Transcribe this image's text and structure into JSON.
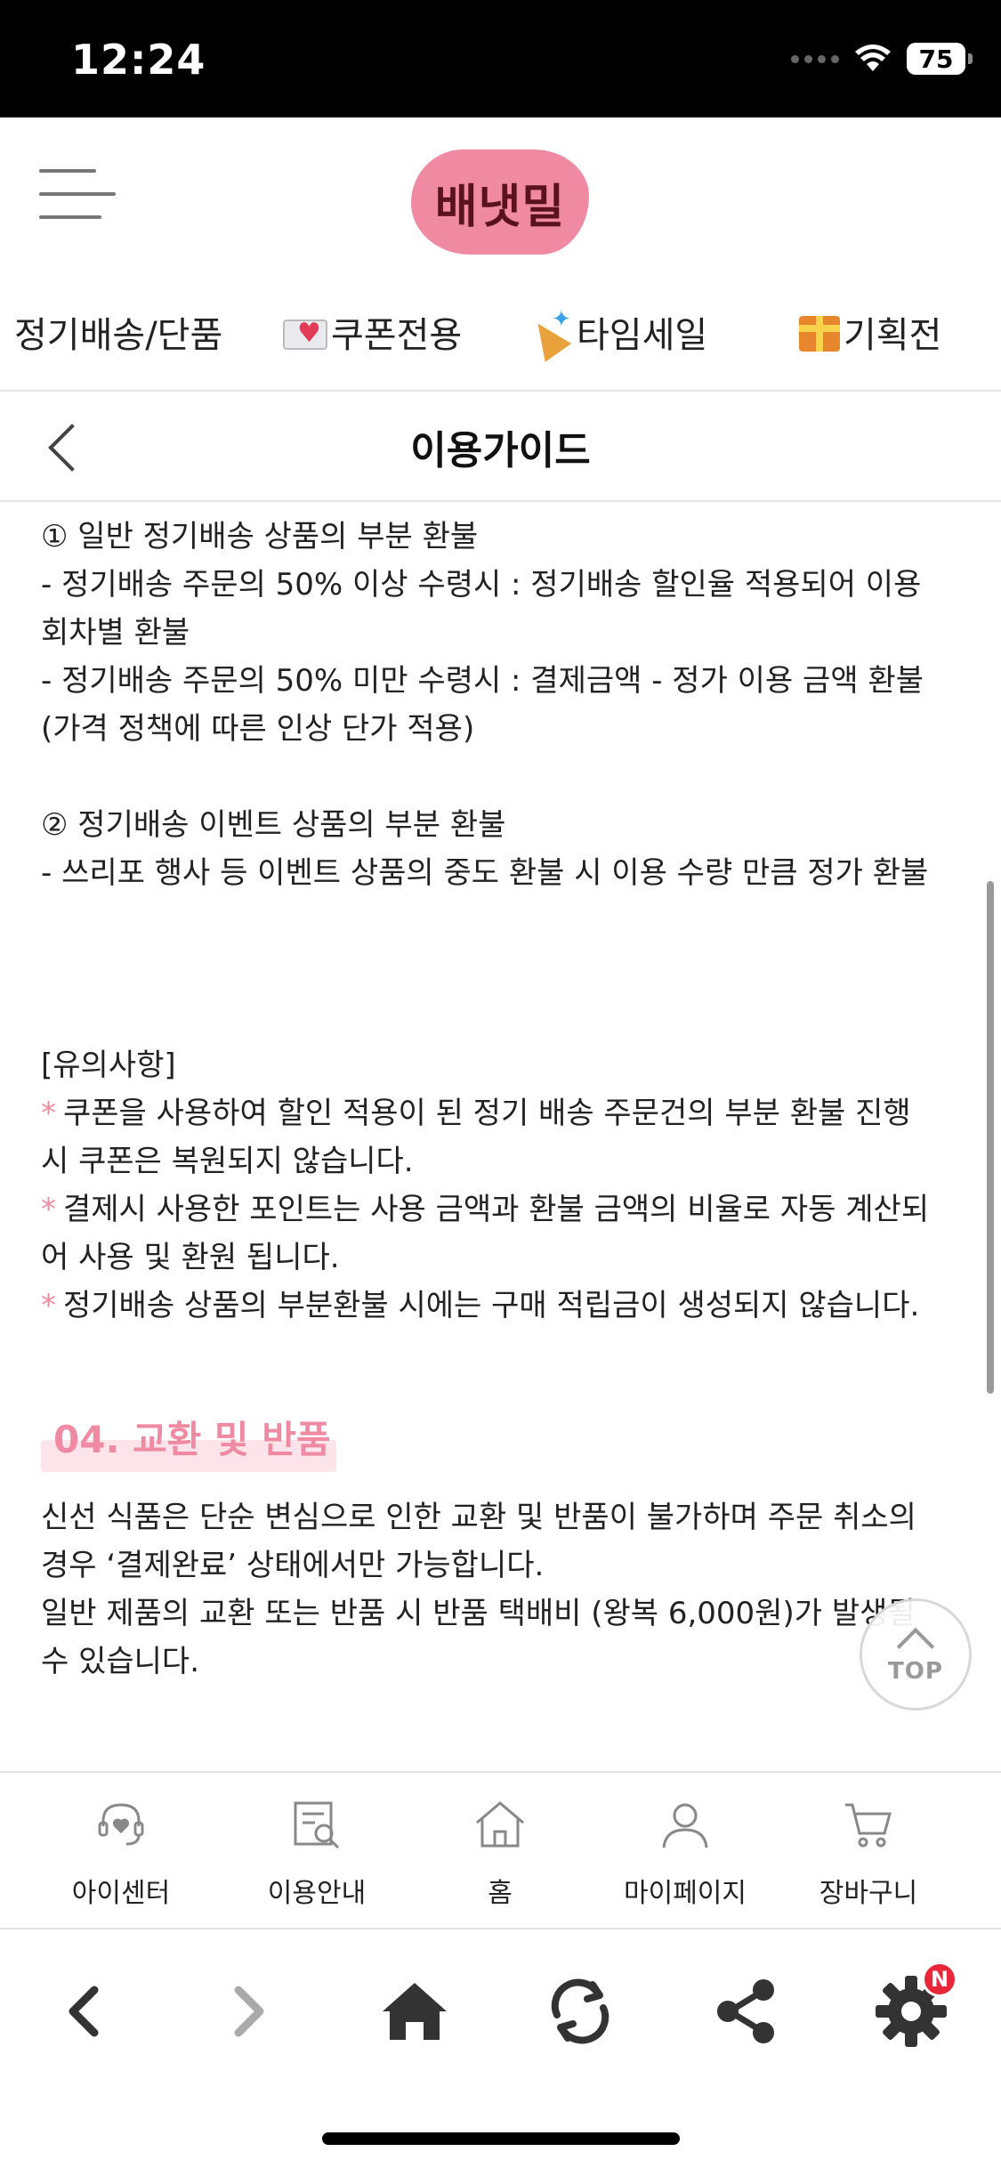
{
  "status_bar": {
    "time": "12:24",
    "battery": "75",
    "icons": [
      "signal-dots-icon",
      "wifi-icon",
      "battery-icon"
    ]
  },
  "header": {
    "logo_text": "배냇밀",
    "menu_icon": "hamburger-menu-icon",
    "colors": {
      "logo_bg": "#f08aa3",
      "logo_text": "#5a1120"
    }
  },
  "categories": [
    {
      "label": "정기배송/단품",
      "icon": ""
    },
    {
      "label": "쿠폰전용",
      "icon": "love-letter-icon"
    },
    {
      "label": "타임세일",
      "icon": "party-popper-icon"
    },
    {
      "label": "기획전",
      "icon": "gift-icon"
    }
  ],
  "page": {
    "title": "이용가이드",
    "back_icon": "back-chevron-icon"
  },
  "content": {
    "partial_refund_general": [
      "① 일반 정기배송 상품의 부분 환불",
      "- 정기배송 주문의 50% 이상 수령시 : 정기배송 할인율 적용되어 이용",
      "회차별 환불",
      "- 정기배송 주문의 50% 미만 수령시 : 결제금액 - 정가 이용 금액 환불",
      "(가격 정책에 따른 인상 단가 적용)"
    ],
    "partial_refund_event": [
      "② 정기배송 이벤트 상품의 부분 환불",
      "- 쓰리포 행사 등 이벤트 상품의 중도 환불 시 이용 수량 만큼 정가 환불"
    ],
    "notice_title": "[유의사항]",
    "notice_star": "*",
    "notices": [
      [
        "쿠폰을 사용하여 할인 적용이 된 정기 배송 주문건의 부분 환불 진행",
        "시 쿠폰은 복원되지 않습니다."
      ],
      [
        "결제시 사용한 포인트는 사용 금액과 환불 금액의 비율로 자동 계산되",
        "어 사용 및 환원 됩니다."
      ],
      [
        "정기배송 상품의 부분환불 시에는 구매 적립금이 생성되지 않습니다."
      ]
    ],
    "section_title": "04. 교환 및 반품",
    "exchange_text": [
      "신선 식품은 단순 변심으로 인한 교환 및 반품이 불가하며 주문 취소의",
      "경우 ‘결제완료’ 상태에서만 가능합니다.",
      "일반 제품의 교환 또는 반품 시 반품 택배비 (왕복 6,000원)가 발생될",
      "수 있습니다."
    ],
    "accent_color": "#f08aa3"
  },
  "top_button": {
    "label": "TOP"
  },
  "tab_bar": [
    {
      "label": "아이센터",
      "icon": "headset-heart-icon"
    },
    {
      "label": "이용안내",
      "icon": "document-search-icon"
    },
    {
      "label": "홈",
      "icon": "house-outline-icon"
    },
    {
      "label": "마이페이지",
      "icon": "person-icon"
    },
    {
      "label": "장바구니",
      "icon": "cart-icon"
    }
  ],
  "browser_bar": {
    "buttons": [
      "back-arrow-icon",
      "forward-arrow-icon",
      "home-icon",
      "refresh-icon",
      "share-icon",
      "settings-gear-icon"
    ],
    "badge": "N"
  }
}
